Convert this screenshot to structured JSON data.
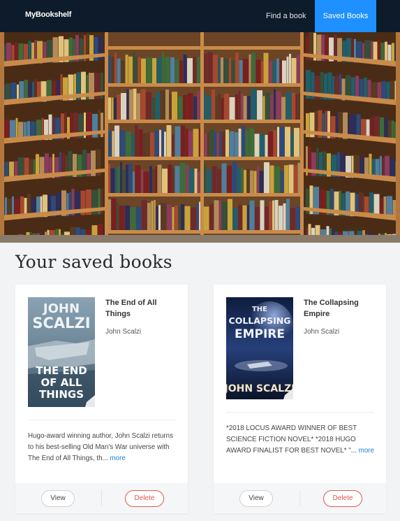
{
  "nav": {
    "brand": "MyBookshelf",
    "find_label": "Find a book",
    "saved_label": "Saved Books"
  },
  "page": {
    "heading": "Your saved books"
  },
  "books": [
    {
      "title": "The End of All Things",
      "author": "John Scalzi",
      "description": "Hugo-award winning author, John Scalzi returns to his best-selling Old Man's War universe with The End of All Things, th...",
      "more_label": "more",
      "view_label": "View",
      "delete_label": "Delete",
      "cover_author": "JOHN SCALZI",
      "cover_title_lines": [
        "THE END",
        "OF ALL",
        "THINGS"
      ]
    },
    {
      "title": "The Collapsing Empire",
      "author": "John Scalzi",
      "description": "*2018 LOCUS AWARD WINNER OF BEST SCIENCE FICTION NOVEL* *2018 HUGO AWARD FINALIST FOR BEST NOVEL* \"...",
      "more_label": "more",
      "view_label": "View",
      "delete_label": "Delete",
      "cover_author": "JOHN SCALZI",
      "cover_title_lines": [
        "THE",
        "COLLAPSING",
        "EMPIRE"
      ]
    }
  ],
  "colors": {
    "navbar": "#0d1b2a",
    "active_nav": "#1e90ff",
    "delete": "#e0584e",
    "link": "#1e7fd6"
  }
}
